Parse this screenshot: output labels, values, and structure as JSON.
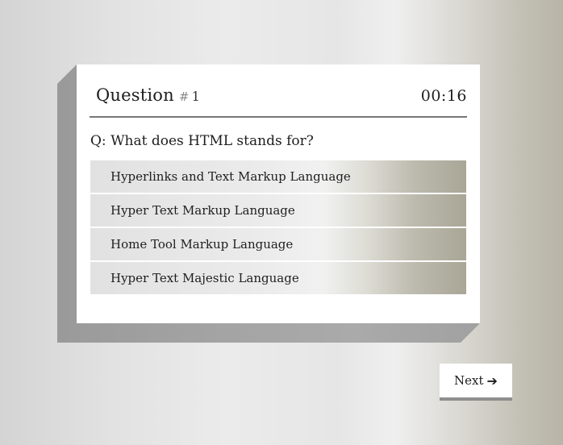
{
  "quiz": {
    "question_label": "Question",
    "question_hash": "#",
    "question_number": "1",
    "timer": "00:16",
    "question_text": "Q: What does HTML stands for?",
    "options": [
      {
        "label": "Hyperlinks and Text Markup Language"
      },
      {
        "label": "Hyper Text Markup Language"
      },
      {
        "label": "Home Tool Markup Language"
      },
      {
        "label": "Hyper Text Majestic Language"
      }
    ]
  },
  "footer": {
    "next_label": "Next",
    "next_icon": "arrow-right-icon"
  }
}
